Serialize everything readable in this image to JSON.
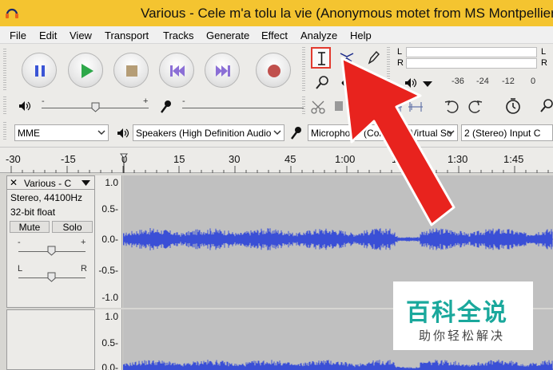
{
  "window": {
    "title": "Various - Cele m'a tolu la vie (Anonymous motet from MS Montpellier,"
  },
  "menu": {
    "items": [
      "File",
      "Edit",
      "View",
      "Transport",
      "Tracks",
      "Generate",
      "Effect",
      "Analyze",
      "Help"
    ]
  },
  "transport": {
    "buttons": [
      "pause",
      "play",
      "stop",
      "skip-to-start",
      "skip-to-end",
      "record"
    ]
  },
  "meter": {
    "left_label": "L",
    "right_label": "R",
    "left_label_2": "L",
    "right_label_2": "R",
    "scale": [
      "-36",
      "-24",
      "-12",
      "0"
    ]
  },
  "device": {
    "host": "MME",
    "output": "Speakers (High Definition Audio",
    "input": "Microphone (Conexant Virtual So",
    "channels": "2 (Stereo) Input C"
  },
  "timeline": {
    "labels": [
      "-30",
      "-15",
      "0",
      "15",
      "30",
      "45",
      "1:00",
      "1:15",
      "1:30",
      "1:45"
    ]
  },
  "track": {
    "name": "Various - C",
    "format": "Stereo, 44100Hz",
    "bitdepth": "32-bit float",
    "mute_label": "Mute",
    "solo_label": "Solo",
    "pan_left": "L",
    "pan_right": "R",
    "gain_minus": "-",
    "gain_plus": "+",
    "close_symbol": "✕",
    "scale": [
      "1.0",
      "0.5-",
      "0.0-",
      "-0.5-",
      "-1.0"
    ],
    "scale2": [
      "1.0",
      "0.5-",
      "0.0-"
    ]
  },
  "watermark": {
    "logo": "百科全说",
    "subtitle": "助你轻松解决"
  },
  "colors": {
    "titlebar": "#f4c430",
    "waveform": "#3a4fd6",
    "highlight": "#e23a2e"
  }
}
